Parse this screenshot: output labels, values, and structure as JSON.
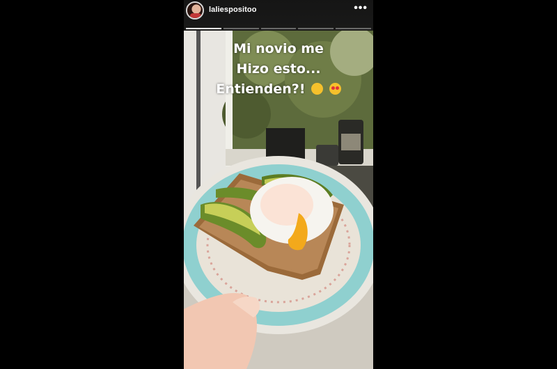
{
  "story": {
    "username": "laliespositoo",
    "more_label": "•••",
    "progress_segments": 5,
    "active_segment": 0,
    "caption_lines": [
      "Mi novio me",
      "Hizo esto...",
      "Entienden?!"
    ],
    "caption_emojis": [
      "smiling-face-with-hearts",
      "heart-eyes"
    ]
  }
}
